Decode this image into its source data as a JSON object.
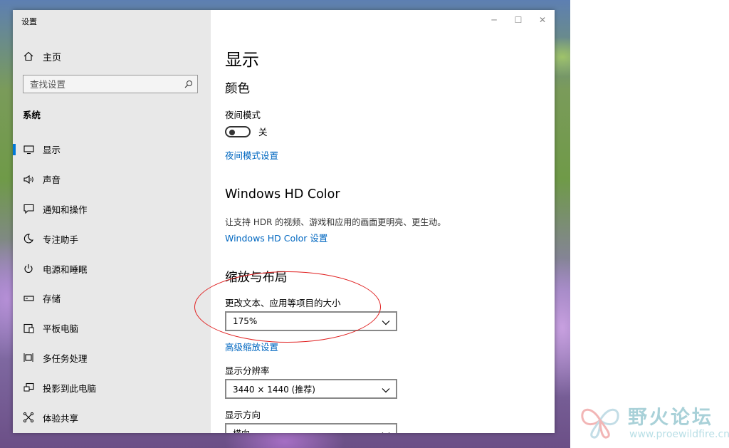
{
  "window": {
    "title": "设置"
  },
  "sidebar": {
    "home_label": "主页",
    "search_placeholder": "查找设置",
    "section_header": "系统",
    "items": [
      {
        "label": "显示",
        "icon": "monitor-icon",
        "active": true
      },
      {
        "label": "声音",
        "icon": "speaker-icon"
      },
      {
        "label": "通知和操作",
        "icon": "notification-icon"
      },
      {
        "label": "专注助手",
        "icon": "moon-icon"
      },
      {
        "label": "电源和睡眠",
        "icon": "power-icon"
      },
      {
        "label": "存储",
        "icon": "storage-icon"
      },
      {
        "label": "平板电脑",
        "icon": "tablet-icon"
      },
      {
        "label": "多任务处理",
        "icon": "multitask-icon"
      },
      {
        "label": "投影到此电脑",
        "icon": "project-icon"
      },
      {
        "label": "体验共享",
        "icon": "share-icon"
      }
    ]
  },
  "main": {
    "page_title": "显示",
    "color": {
      "heading": "颜色",
      "night_mode_label": "夜间模式",
      "night_mode_state": "关",
      "night_mode_link": "夜间模式设置"
    },
    "hdr": {
      "heading": "Windows HD Color",
      "description": "让支持 HDR 的视频、游戏和应用的画面更明亮、更生动。",
      "link": "Windows HD Color 设置"
    },
    "scale": {
      "heading": "缩放与布局",
      "text_size_label": "更改文本、应用等项目的大小",
      "text_size_value": "175%",
      "advanced_link": "高级缩放设置",
      "resolution_label": "显示分辨率",
      "resolution_value": "3440 × 1440 (推荐)",
      "orientation_label": "显示方向",
      "orientation_value": "横向"
    }
  },
  "watermark": {
    "title": "野火论坛",
    "url": "www.proewildfire.cn"
  },
  "colors": {
    "accent": "#0078d7",
    "link": "#0067c0",
    "annotation": "#e02020",
    "sidebar_bg": "#e8e8e8"
  }
}
